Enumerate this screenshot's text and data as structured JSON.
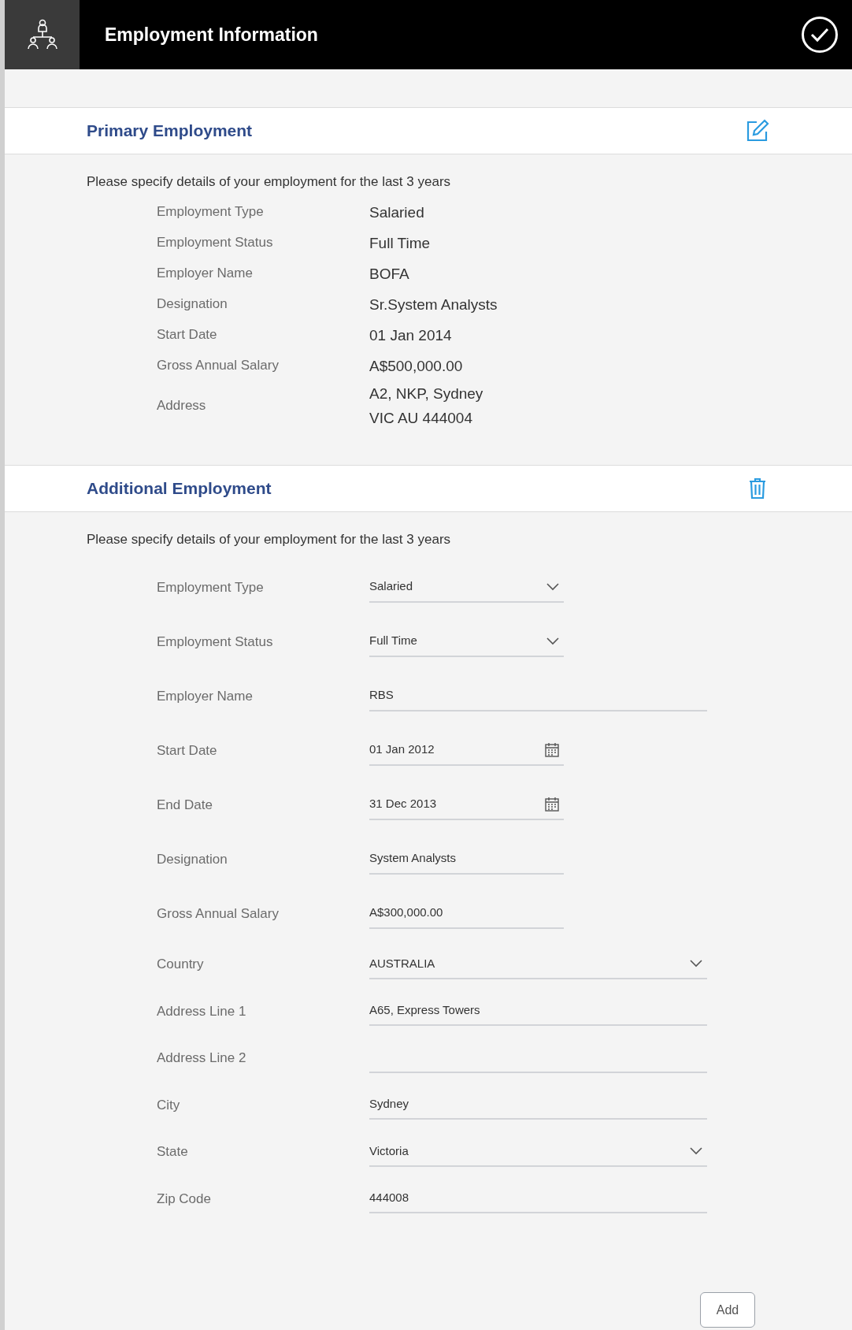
{
  "header": {
    "title": "Employment Information"
  },
  "primary": {
    "title": "Primary Employment",
    "intro": "Please specify details of your employment for the last 3 years",
    "details": [
      {
        "label": "Employment Type",
        "value": [
          "Salaried"
        ]
      },
      {
        "label": "Employment Status",
        "value": [
          "Full Time"
        ]
      },
      {
        "label": "Employer Name",
        "value": [
          "BOFA"
        ]
      },
      {
        "label": "Designation",
        "value": [
          "Sr.System Analysts"
        ]
      },
      {
        "label": "Start Date",
        "value": [
          "01 Jan 2014"
        ]
      },
      {
        "label": "Gross Annual Salary",
        "value": [
          "A$500,000.00"
        ]
      },
      {
        "label": "Address",
        "value": [
          "A2, NKP, Sydney",
          "VIC AU 444004"
        ]
      }
    ]
  },
  "additional": {
    "title": "Additional Employment",
    "intro": "Please specify details of your employment for the last 3 years",
    "fields": [
      {
        "label": "Employment Type",
        "kind": "select",
        "value": "Salaried"
      },
      {
        "label": "Employment Status",
        "kind": "select",
        "value": "Full Time"
      },
      {
        "label": "Employer Name",
        "kind": "text",
        "value": "RBS"
      },
      {
        "label": "Start Date",
        "kind": "date",
        "value": "01 Jan 2012"
      },
      {
        "label": "End Date",
        "kind": "date",
        "value": "31 Dec 2013"
      },
      {
        "label": "Designation",
        "kind": "text",
        "value": "System Analysts"
      },
      {
        "label": "Gross Annual Salary",
        "kind": "text",
        "value": "A$300,000.00"
      },
      {
        "label": "Country",
        "kind": "select",
        "value": "AUSTRALIA"
      },
      {
        "label": "Address Line 1",
        "kind": "text",
        "value": "A65, Express Towers"
      },
      {
        "label": "Address Line 2",
        "kind": "text"
      },
      {
        "label": "City",
        "kind": "text",
        "value": "Sydney"
      },
      {
        "label": "State",
        "kind": "select",
        "value": "Victoria"
      },
      {
        "label": "Zip Code",
        "kind": "text",
        "value": "444008"
      }
    ]
  },
  "buttons": [
    "Add"
  ]
}
